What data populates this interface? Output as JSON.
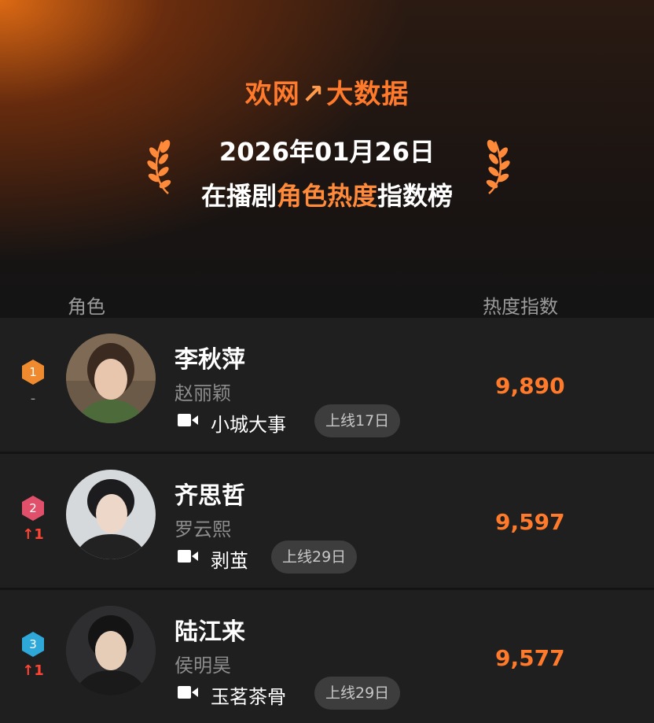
{
  "header": {
    "logo_left": "欢网",
    "logo_mark": "↗",
    "logo_right": "大数据",
    "date": "2026年01月26日",
    "title_prefix": "在播剧",
    "title_highlight": "角色热度",
    "title_suffix": "指数榜"
  },
  "columns": {
    "role": "角色",
    "heat": "热度指数"
  },
  "colors": {
    "accent": "#ff7a2a",
    "rank1": "#f08a2e",
    "rank2": "#e0506a",
    "rank3": "#2ea8d8",
    "up": "#ff4433"
  },
  "rows": [
    {
      "rank": "1",
      "change": "-",
      "character": "李秋萍",
      "actor": "赵丽颖",
      "drama": "小城大事",
      "online": "上线17日",
      "score": "9,890",
      "video_icon": "video-camera-icon"
    },
    {
      "rank": "2",
      "change": "↑1",
      "character": "齐思哲",
      "actor": "罗云熙",
      "drama": "剥茧",
      "online": "上线29日",
      "score": "9,597",
      "video_icon": "video-camera-icon"
    },
    {
      "rank": "3",
      "change": "↑1",
      "character": "陆江来",
      "actor": "侯明昊",
      "drama": "玉茗茶骨",
      "online": "上线29日",
      "score": "9,577",
      "video_icon": "video-camera-icon"
    }
  ]
}
